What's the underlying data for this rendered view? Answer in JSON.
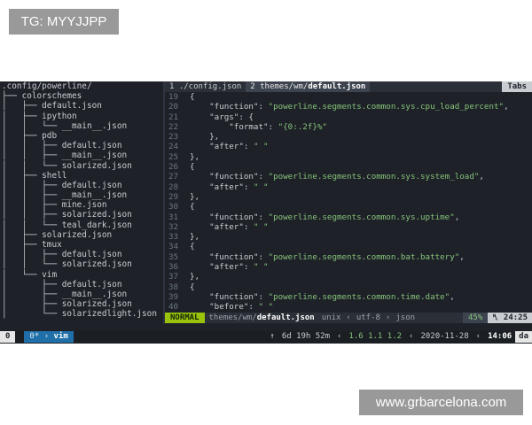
{
  "watermark": {
    "tag": "TG: MYYJJPP",
    "site": "www.grbarcelona.com"
  },
  "tree": {
    "lines": [
      ".config/powerline/",
      "├── colorschemes",
      "│   ├── default.json",
      "│   ├── ipython",
      "│   │   └── __main__.json",
      "│   ├── pdb",
      "│   │   ├── default.json",
      "│   │   ├── __main__.json",
      "│   │   └── solarized.json",
      "│   ├── shell",
      "│   │   ├── default.json",
      "│   │   ├── __main__.json",
      "│   │   ├── mine.json",
      "│   │   ├── solarized.json",
      "│   │   └── teal_dark.json",
      "│   ├── solarized.json",
      "│   ├── tmux",
      "│   │   ├── default.json",
      "│   │   └── solarized.json",
      "│   └── vim",
      "│       ├── default.json",
      "│       ├── __main__.json",
      "│       ├── solarized.json",
      "│       └── solarizedlight.json",
      ":"
    ]
  },
  "tabs": {
    "tab1": "1 ./config.json",
    "tab2_prefix": "2 themes/wm/",
    "tab2_file": "default.json",
    "label": "Tabs"
  },
  "code": [
    {
      "n": "19",
      "t": "{"
    },
    {
      "n": "20",
      "t": "    \"function\": \"powerline.segments.common.sys.cpu_load_percent\","
    },
    {
      "n": "21",
      "t": "    \"args\": {"
    },
    {
      "n": "22",
      "t": "        \"format\": \"{0:.2f}%\""
    },
    {
      "n": "23",
      "t": "    },"
    },
    {
      "n": "24",
      "t": "    \"after\": \" \""
    },
    {
      "n": "25",
      "t": "},"
    },
    {
      "n": "26",
      "t": "{"
    },
    {
      "n": "27",
      "t": "    \"function\": \"powerline.segments.common.sys.system_load\","
    },
    {
      "n": "28",
      "t": "    \"after\": \" \""
    },
    {
      "n": "29",
      "t": "},"
    },
    {
      "n": "30",
      "t": "{"
    },
    {
      "n": "31",
      "t": "    \"function\": \"powerline.segments.common.sys.uptime\","
    },
    {
      "n": "32",
      "t": "    \"after\": \" \""
    },
    {
      "n": "33",
      "t": "},"
    },
    {
      "n": "34",
      "t": "{"
    },
    {
      "n": "35",
      "t": "    \"function\": \"powerline.segments.common.bat.battery\","
    },
    {
      "n": "36",
      "t": "    \"after\": \" \""
    },
    {
      "n": "37",
      "t": "},"
    },
    {
      "n": "38",
      "t": "{"
    },
    {
      "n": "39",
      "t": "    \"function\": \"powerline.segments.common.time.date\","
    },
    {
      "n": "40",
      "t": "    \"before\": \" \""
    }
  ],
  "statusline": {
    "mode": "NORMAL",
    "file_prefix": "themes/wm/",
    "file_name": "default.json",
    "format": "unix",
    "encoding": "utf-8",
    "filetype": "json",
    "percent": "45%",
    "position": "24:25"
  },
  "tmux": {
    "session": "0",
    "window_index": "0*",
    "window_name": "vim",
    "uptime": "6d 19h 52m",
    "load": "1.6 1.1 1.2",
    "date": "2020-11-28",
    "time": "14:06",
    "host": "da"
  },
  "colors": {
    "background": "#1e2228",
    "mode": "#9ac20a",
    "string": "#86c27a",
    "window": "#1f6fa8"
  }
}
